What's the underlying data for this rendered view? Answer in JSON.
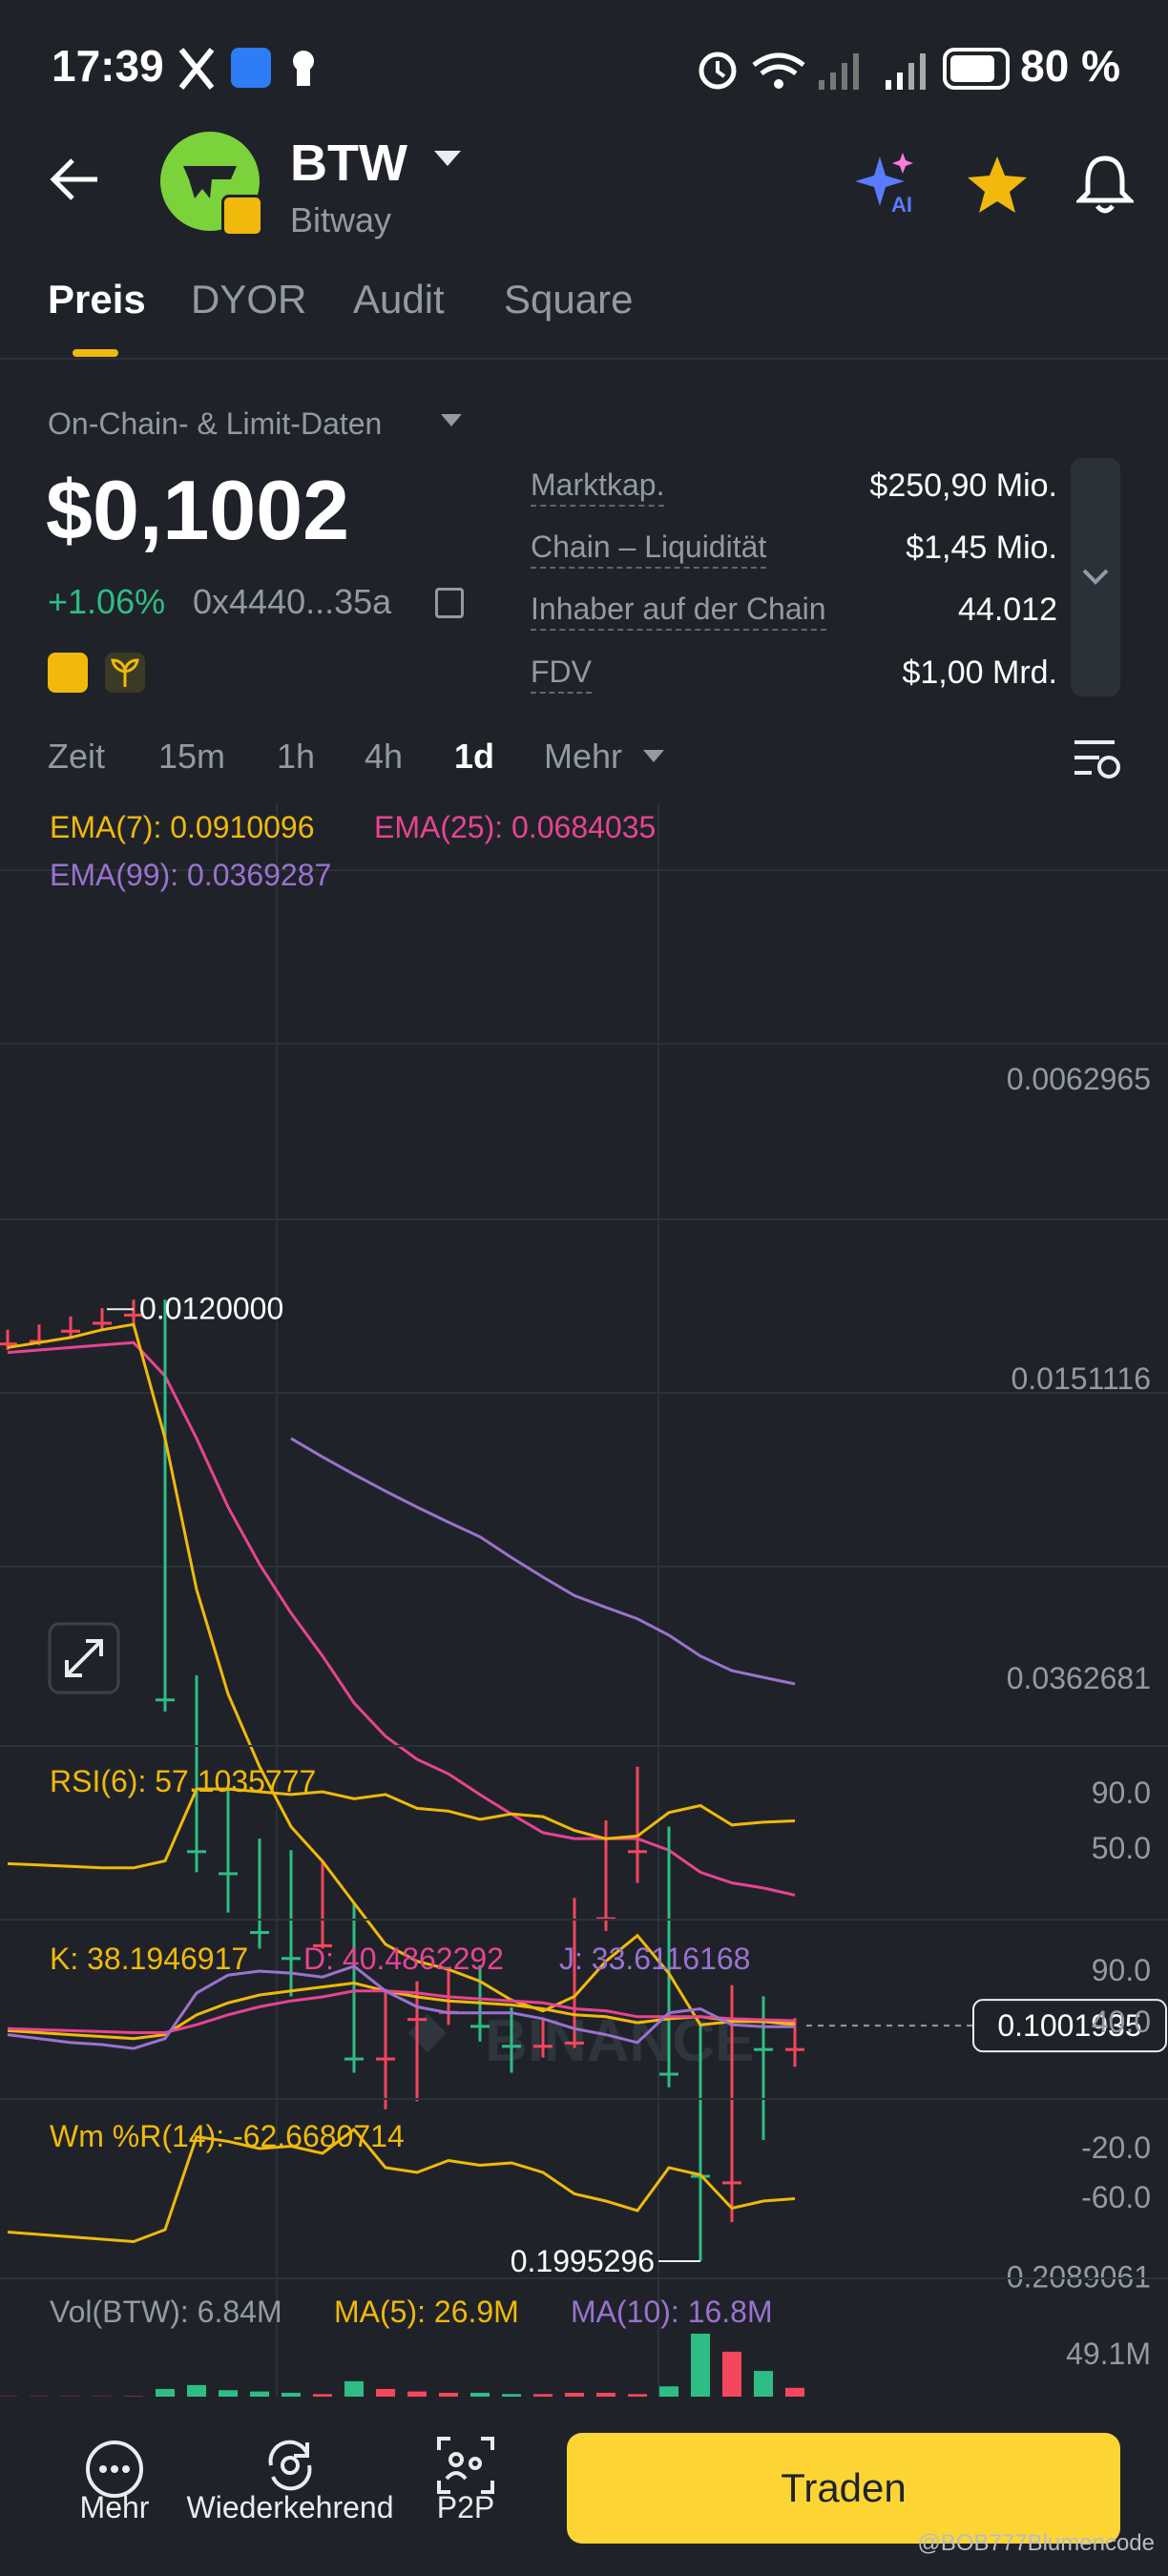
{
  "status_bar": {
    "time": "17:39",
    "battery": "80 %"
  },
  "header": {
    "ticker": "BTW",
    "name": "Bitway",
    "ai_label": "AI"
  },
  "tabs": [
    {
      "label": "Preis",
      "active": true
    },
    {
      "label": "DYOR",
      "active": false
    },
    {
      "label": "Audit",
      "active": false
    },
    {
      "label": "Square",
      "active": false
    }
  ],
  "data_source": "On-Chain- & Limit-Daten",
  "price": "$0,1002",
  "change": "+1.06%",
  "contract": "0x4440...35a",
  "stats": [
    {
      "label": "Marktkap.",
      "value": "$250,90 Mio."
    },
    {
      "label": "Chain – Liquidität",
      "value": "$1,45 Mio."
    },
    {
      "label": "Inhaber auf der Chain",
      "value": "44.012"
    },
    {
      "label": "FDV",
      "value": "$1,00 Mrd."
    }
  ],
  "timeframes": [
    {
      "label": "Zeit",
      "active": false
    },
    {
      "label": "15m",
      "active": false
    },
    {
      "label": "1h",
      "active": false
    },
    {
      "label": "4h",
      "active": false
    },
    {
      "label": "1d",
      "active": true
    },
    {
      "label": "Mehr",
      "active": false
    }
  ],
  "chart_data": {
    "type": "candlestick",
    "watermark": "BINANCE",
    "y_scale": "log",
    "y_ticks": [
      "0.2089061",
      "0.0362681",
      "0.0151116",
      "0.0062965"
    ],
    "current_price_label": "0.1001935",
    "high_label": "0.1995296",
    "low_label": "0.0120000",
    "ema_labels": [
      "EMA(7): 0.0910096",
      "EMA(25): 0.0684035",
      "EMA(99): 0.0369287"
    ],
    "candles": [
      {
        "o": 0.0136,
        "h": 0.0139,
        "l": 0.0131,
        "c": 0.0135
      },
      {
        "o": 0.0135,
        "h": 0.0137,
        "l": 0.0129,
        "c": 0.0131
      },
      {
        "o": 0.0131,
        "h": 0.0134,
        "l": 0.0126,
        "c": 0.0128
      },
      {
        "o": 0.0128,
        "h": 0.0131,
        "l": 0.0123,
        "c": 0.0125
      },
      {
        "o": 0.0125,
        "h": 0.013,
        "l": 0.012,
        "c": 0.0124
      },
      {
        "o": 0.0124,
        "h": 0.04,
        "l": 0.012,
        "c": 0.0385
      },
      {
        "o": 0.0385,
        "h": 0.064,
        "l": 0.036,
        "c": 0.06
      },
      {
        "o": 0.06,
        "h": 0.072,
        "l": 0.05,
        "c": 0.064
      },
      {
        "o": 0.064,
        "h": 0.08,
        "l": 0.058,
        "c": 0.076
      },
      {
        "o": 0.076,
        "h": 0.092,
        "l": 0.06,
        "c": 0.082
      },
      {
        "o": 0.079,
        "h": 0.08,
        "l": 0.062,
        "c": 0.077
      },
      {
        "o": 0.077,
        "h": 0.115,
        "l": 0.07,
        "c": 0.11
      },
      {
        "o": 0.11,
        "h": 0.128,
        "l": 0.09,
        "c": 0.098
      },
      {
        "o": 0.098,
        "h": 0.125,
        "l": 0.088,
        "c": 0.096
      },
      {
        "o": 0.096,
        "h": 0.1,
        "l": 0.085,
        "c": 0.088
      },
      {
        "o": 0.088,
        "h": 0.105,
        "l": 0.084,
        "c": 0.1
      },
      {
        "o": 0.1,
        "h": 0.115,
        "l": 0.095,
        "c": 0.106
      },
      {
        "o": 0.106,
        "h": 0.11,
        "l": 0.098,
        "c": 0.104
      },
      {
        "o": 0.105,
        "h": 0.107,
        "l": 0.069,
        "c": 0.073
      },
      {
        "o": 0.073,
        "h": 0.076,
        "l": 0.055,
        "c": 0.06
      },
      {
        "o": 0.06,
        "h": 0.066,
        "l": 0.047,
        "c": 0.058
      },
      {
        "o": 0.058,
        "h": 0.12,
        "l": 0.056,
        "c": 0.115
      },
      {
        "o": 0.115,
        "h": 0.1995,
        "l": 0.1,
        "c": 0.155
      },
      {
        "o": 0.158,
        "h": 0.178,
        "l": 0.089,
        "c": 0.098
      },
      {
        "o": 0.099,
        "h": 0.14,
        "l": 0.092,
        "c": 0.107
      },
      {
        "o": 0.107,
        "h": 0.113,
        "l": 0.098,
        "c": 0.1002
      }
    ],
    "ema7": [
      0.0138,
      0.0136,
      0.0134,
      0.0131,
      0.0129,
      0.018,
      0.028,
      0.038,
      0.047,
      0.056,
      0.062,
      0.07,
      0.079,
      0.083,
      0.085,
      0.088,
      0.093,
      0.096,
      0.092,
      0.083,
      0.077,
      0.086,
      0.1,
      0.099,
      0.099,
      0.1
    ],
    "ema25": [
      0.014,
      0.0139,
      0.0138,
      0.0137,
      0.0136,
      0.015,
      0.018,
      0.022,
      0.026,
      0.03,
      0.034,
      0.039,
      0.043,
      0.046,
      0.048,
      0.051,
      0.054,
      0.057,
      0.058,
      0.058,
      0.058,
      0.06,
      0.064,
      0.066,
      0.067,
      0.0684
    ],
    "ema99_start_index": 9,
    "ema99": [
      0.018,
      0.019,
      0.02,
      0.021,
      0.022,
      0.023,
      0.024,
      0.0255,
      0.027,
      0.0285,
      0.0295,
      0.0305,
      0.032,
      0.034,
      0.0355,
      0.0362,
      0.0369
    ],
    "rsi_label": "RSI(6): 57.1035777",
    "rsi_ticks": [
      "90.0",
      "50.0"
    ],
    "rsi": [
      38,
      37,
      36,
      35,
      35,
      40,
      92,
      92,
      90,
      88,
      90,
      85,
      88,
      78,
      76,
      70,
      74,
      72,
      62,
      56,
      58,
      75,
      80,
      66,
      68,
      69
    ],
    "kdj_labels": [
      "K: 38.1946917",
      "D: 40.4862292",
      "J: 33.6116168"
    ],
    "kdj_ticks": [
      "90.0",
      "40.0"
    ],
    "k": [
      30,
      28,
      26,
      24,
      22,
      26,
      46,
      58,
      66,
      70,
      74,
      78,
      70,
      64,
      60,
      58,
      56,
      52,
      46,
      44,
      38,
      42,
      44,
      40,
      39,
      38
    ],
    "d": [
      32,
      31,
      30,
      29,
      28,
      28,
      36,
      46,
      54,
      60,
      64,
      70,
      70,
      68,
      64,
      62,
      60,
      58,
      52,
      50,
      44,
      44,
      44,
      42,
      41,
      40
    ],
    "j": [
      26,
      22,
      18,
      16,
      12,
      22,
      68,
      86,
      90,
      88,
      84,
      95,
      70,
      54,
      48,
      48,
      48,
      42,
      32,
      26,
      18,
      48,
      52,
      36,
      34,
      34
    ],
    "wr_label": "Wm %R(14): -62.6680714",
    "wr_ticks": [
      "-20.0",
      "-60.0"
    ],
    "wr": [
      -90,
      -92,
      -94,
      -96,
      -98,
      -88,
      -10,
      -14,
      -20,
      -18,
      -24,
      -4,
      -36,
      -40,
      -30,
      -34,
      -32,
      -40,
      -58,
      -64,
      -72,
      -36,
      -42,
      -70,
      -64,
      -62
    ],
    "vol_labels": [
      "Vol(BTW): 6.84M",
      "MA(5): 26.9M",
      "MA(10): 16.8M"
    ],
    "vol_tick": "49.1M",
    "volume": [
      0.2,
      0.2,
      0.2,
      0.2,
      0.3,
      6,
      9,
      5,
      4,
      3,
      2,
      12,
      6,
      4,
      3,
      3,
      2,
      2,
      3,
      3,
      2,
      8,
      49.1,
      35,
      20,
      6.84
    ]
  },
  "bottom_nav": [
    {
      "label": "Mehr"
    },
    {
      "label": "Wiederkehrend"
    },
    {
      "label": "P2P"
    }
  ],
  "trade_button": "Traden",
  "credit": "@BOB777Blumencode",
  "colors": {
    "up": "#2ebd85",
    "down": "#f6465d",
    "ema7": "#f0b90b",
    "ema25": "#e84393",
    "ema99": "#9b72cf",
    "accent": "#fcd535"
  }
}
